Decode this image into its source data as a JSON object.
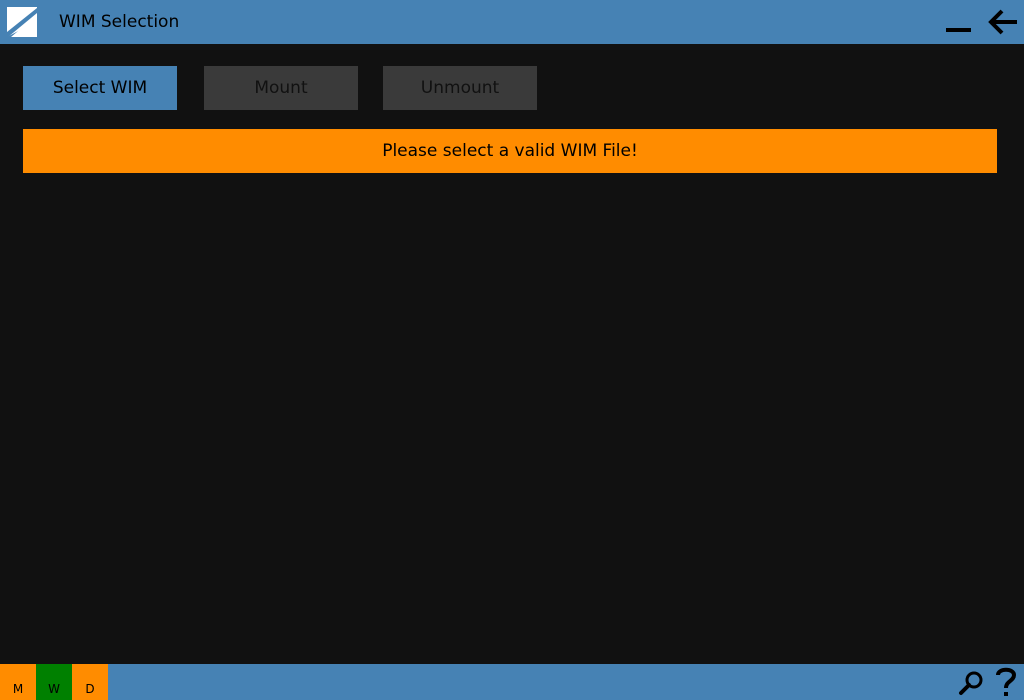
{
  "window": {
    "title": "WIM Selection",
    "logo_icon": "app-logo-icon",
    "minimize_icon": "minimize-icon",
    "back_icon": "arrow-left-icon"
  },
  "toolbar": {
    "select_label": "Select WIM",
    "mount_label": "Mount",
    "unmount_label": "Unmount"
  },
  "status_message": {
    "text": "Please select a valid WIM File!",
    "color": "#ff8c00"
  },
  "statusbar": {
    "tiles": [
      {
        "label": "M",
        "color": "#ff8c00"
      },
      {
        "label": "W",
        "color": "#008000"
      },
      {
        "label": "D",
        "color": "#ff8c00"
      }
    ],
    "search_icon": "search-icon",
    "help_icon": "help-icon"
  },
  "colors": {
    "accent": "#4682b4",
    "background": "#111111",
    "disabled_button": "#3a3a3a",
    "warning": "#ff8c00"
  }
}
